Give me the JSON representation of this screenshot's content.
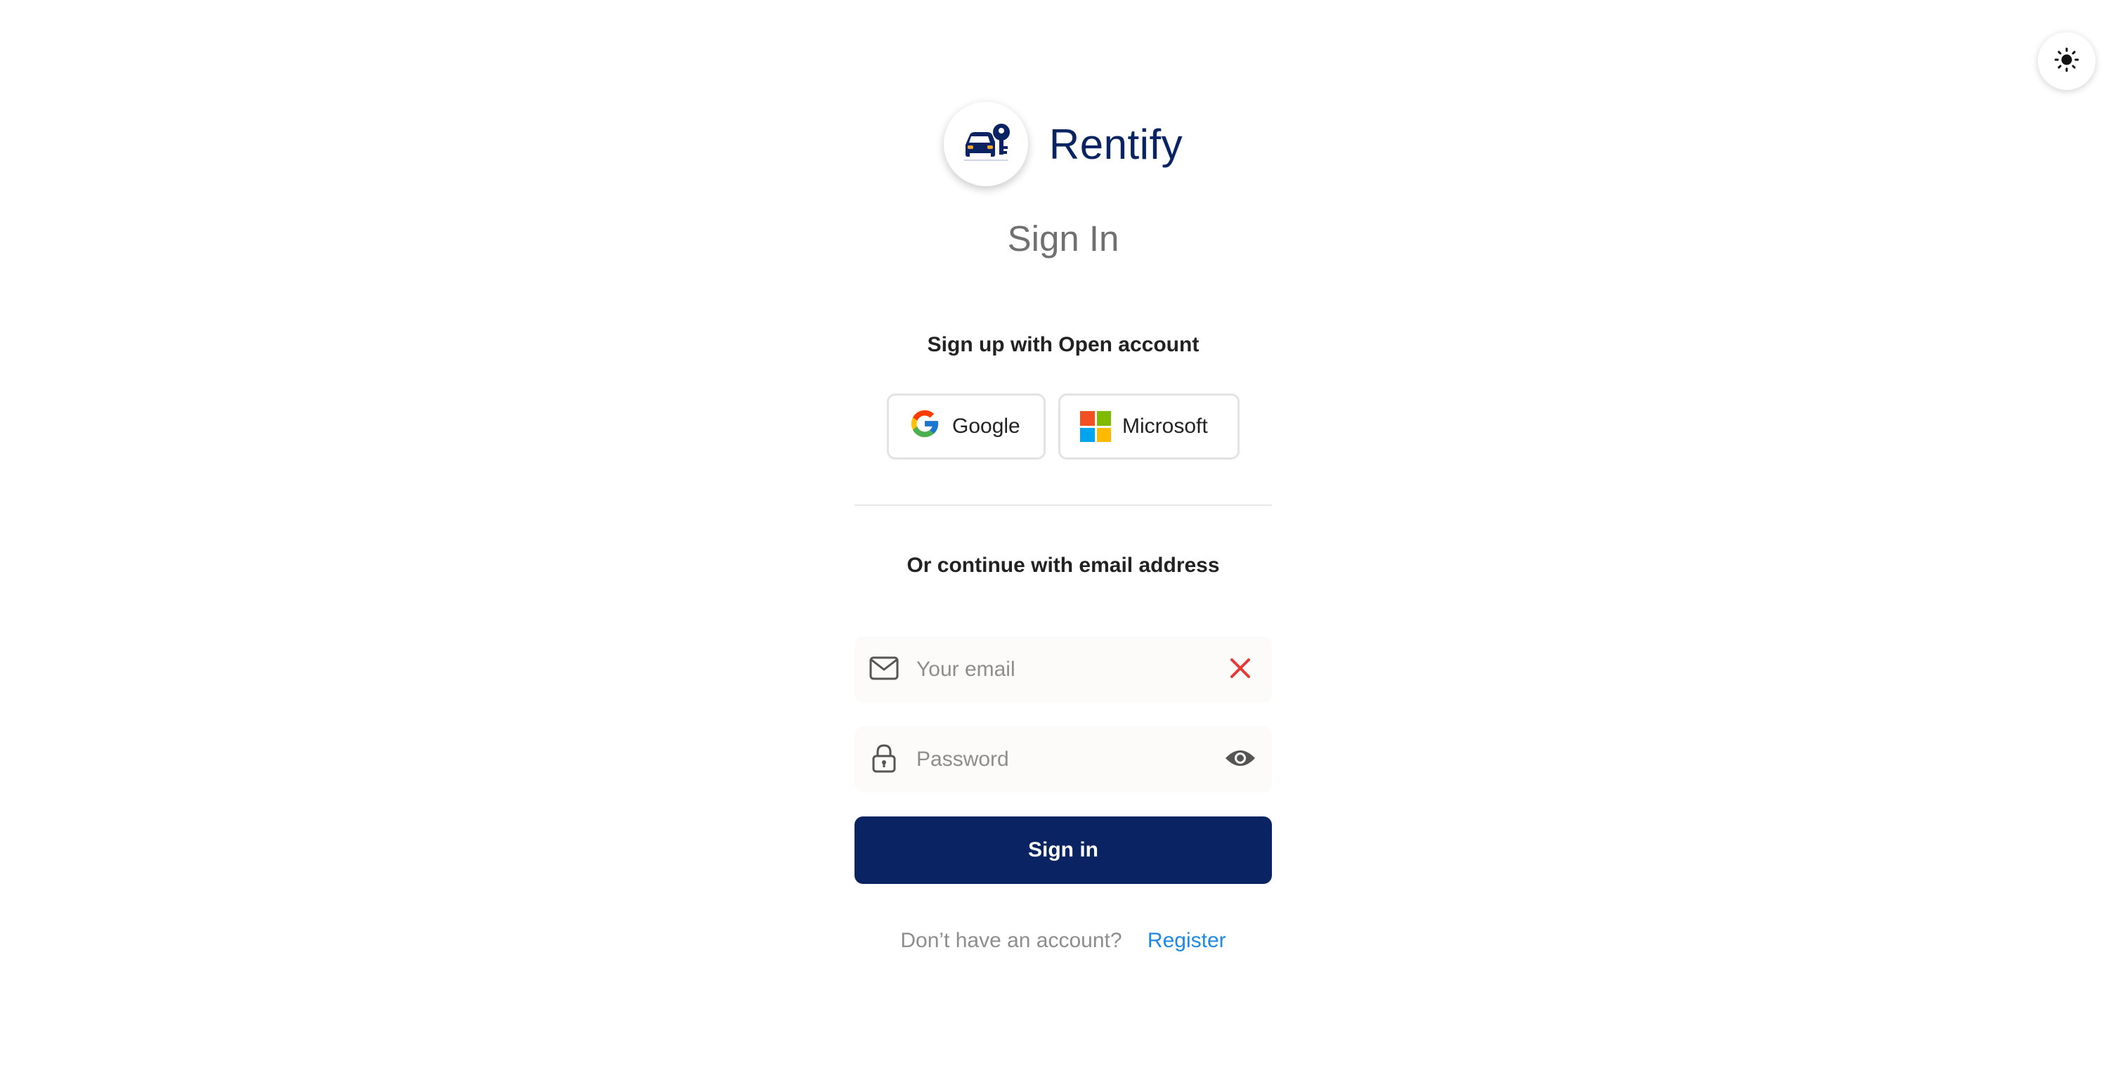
{
  "brand": {
    "name": "Rentify"
  },
  "title": "Sign In",
  "oauth": {
    "label": "Sign up with Open account",
    "google_label": "Google",
    "microsoft_label": "Microsoft"
  },
  "email_section": {
    "label": "Or continue with email address"
  },
  "fields": {
    "email": {
      "placeholder": "Your email",
      "value": ""
    },
    "password": {
      "placeholder": "Password",
      "value": ""
    }
  },
  "submit": {
    "label": "Sign in"
  },
  "register": {
    "prompt": "Don’t have an account?",
    "link_label": "Register"
  },
  "colors": {
    "brand": "#0a2463",
    "link": "#1e88e5",
    "error": "#e53935"
  },
  "icons": {
    "theme": "sun-icon",
    "logo": "car-key-icon",
    "email": "mail-icon",
    "email_trailing": "close-icon",
    "password": "lock-icon",
    "password_trailing": "eye-icon"
  }
}
